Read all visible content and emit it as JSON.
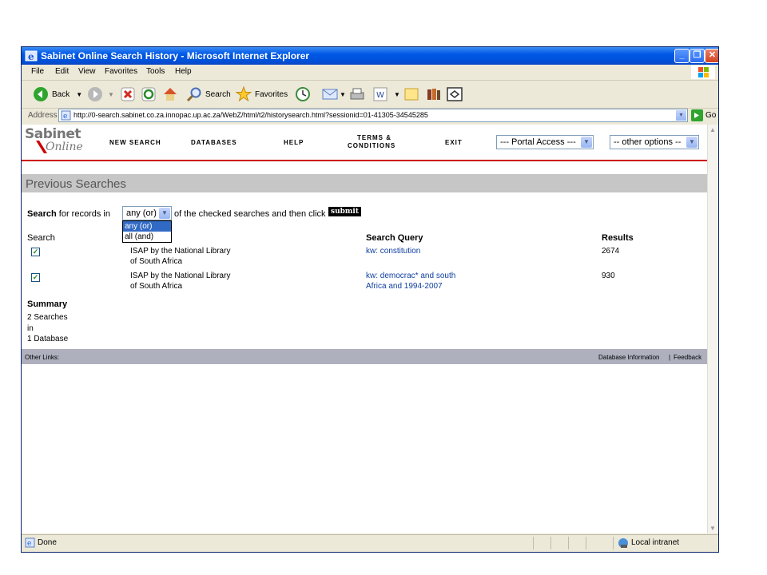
{
  "window": {
    "title": "Sabinet Online Search History - Microsoft Internet Explorer"
  },
  "menu": [
    "File",
    "Edit",
    "View",
    "Favorites",
    "Tools",
    "Help"
  ],
  "toolbar": {
    "back": "Back",
    "search": "Search",
    "favorites": "Favorites"
  },
  "address": {
    "label": "Address",
    "url": "http://0-search.sabinet.co.za.innopac.up.ac.za/WebZ/html/t2/historysearch.html?sessionid=01-41305-34545285",
    "go": "Go"
  },
  "site": {
    "logo_top": "Sabinet",
    "logo_bottom": "Online",
    "nav": [
      "NEW SEARCH",
      "DATABASES",
      "HELP",
      "TERMS &",
      "CONDITIONS",
      "EXIT"
    ],
    "portal_select": "--- Portal Access ---",
    "options_select": "-- other options --"
  },
  "section_title": "Previous Searches",
  "search_row": {
    "label_bold": "Search",
    "label_rest": "for records in",
    "select_value": "any (or)",
    "after_text": "of the checked searches and then click",
    "submit": "submit"
  },
  "dropdown_options": [
    "any (or)",
    "all (and)"
  ],
  "table": {
    "headers": {
      "search": "Search",
      "query": "Search Query",
      "results": "Results"
    },
    "rows": [
      {
        "db_line1": "ISAP by the National Library",
        "db_line2": "of South Africa",
        "q_line1": "kw: constitution",
        "q_line2": "",
        "results": "2674"
      },
      {
        "db_line1": "ISAP by the National Library",
        "db_line2": "of South Africa",
        "q_line1": "kw: democrac* and south",
        "q_line2": "Africa and 1994-2007",
        "results": "930"
      }
    ]
  },
  "summary": {
    "title": "Summary",
    "line1": "2 Searches",
    "line2": "in",
    "line3": "1 Database"
  },
  "footer": {
    "left": "Other Links:",
    "db_info": "Database Information",
    "sep": "|",
    "feedback": "Feedback"
  },
  "status": {
    "left": "Done",
    "zone": "Local intranet"
  }
}
